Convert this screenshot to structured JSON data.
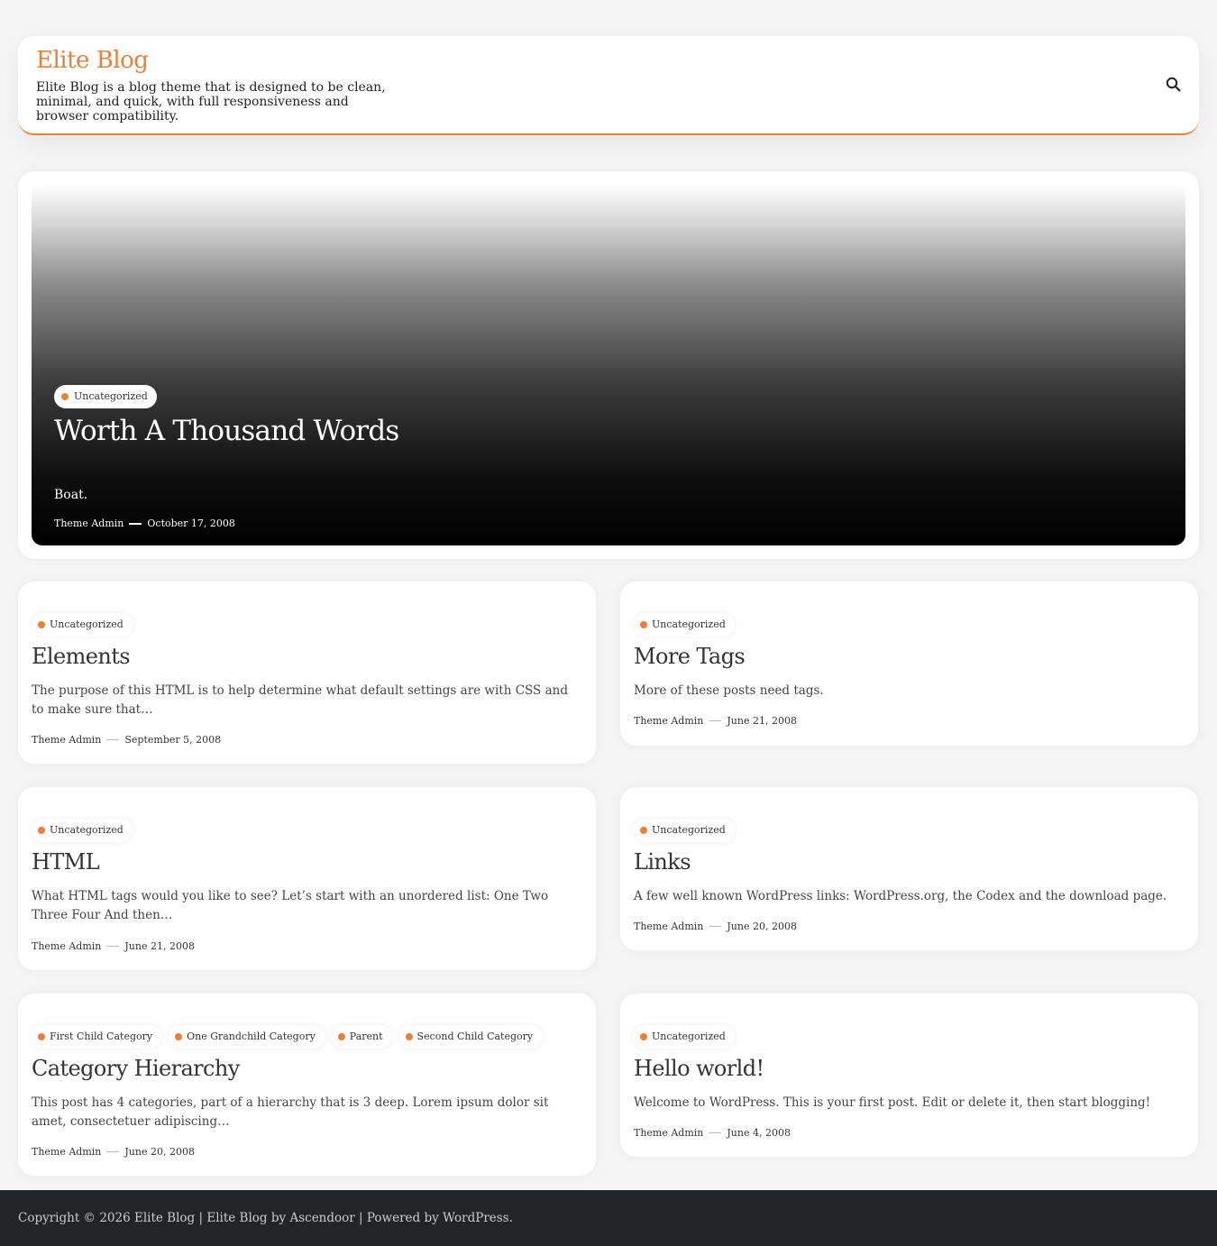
{
  "header": {
    "site_title": "Elite Blog",
    "site_description": "Elite Blog is a blog theme that is designed to be clean, minimal, and quick, with full responsiveness and browser compatibility.",
    "search_icon": "search-icon"
  },
  "featured": {
    "category": "Uncategorized",
    "title": "Worth A Thousand Words",
    "excerpt": "Boat.",
    "author": "Theme Admin",
    "date": "October 17, 2008"
  },
  "posts": [
    {
      "categories": [
        "Uncategorized"
      ],
      "title": "Elements",
      "excerpt": "The purpose of this HTML is to help determine what default settings are with CSS and to make sure that…",
      "author": "Theme Admin",
      "date": "September 5, 2008"
    },
    {
      "categories": [
        "Uncategorized"
      ],
      "title": "More Tags",
      "excerpt": "More of these posts need tags.",
      "author": "Theme Admin",
      "date": "June 21, 2008"
    },
    {
      "categories": [
        "Uncategorized"
      ],
      "title": "HTML",
      "excerpt": "What HTML tags would you like to see? Let’s start with an unordered list: One Two Three Four And then…",
      "author": "Theme Admin",
      "date": "June 21, 2008"
    },
    {
      "categories": [
        "Uncategorized"
      ],
      "title": "Links",
      "excerpt": "A few well known WordPress links: WordPress.org, the Codex and the download page.",
      "author": "Theme Admin",
      "date": "June 20, 2008"
    },
    {
      "categories": [
        "First Child Category",
        "One Grandchild Category",
        "Parent",
        "Second Child Category"
      ],
      "title": "Category Hierarchy",
      "excerpt": "This post has 4 categories, part of a hierarchy that is 3 deep. Lorem ipsum dolor sit amet, consectetuer adipiscing…",
      "author": "Theme Admin",
      "date": "June 20, 2008"
    },
    {
      "categories": [
        "Uncategorized"
      ],
      "title": "Hello world!",
      "excerpt": "Welcome to WordPress. This is your first post. Edit or delete it, then start blogging!",
      "author": "Theme Admin",
      "date": "June 4, 2008"
    }
  ],
  "footer": {
    "copyright": "Copyright © 2026 Elite Blog",
    "separator1": "|",
    "theme_name": "Elite Blog",
    "by": "by",
    "author_link": "Ascendoor",
    "separator2": "|",
    "powered_by": "Powered by",
    "wp_link": "WordPress",
    "end": "."
  },
  "colors": {
    "accent": "#e8803a",
    "footer_bg": "#232427",
    "page_bg": "#f5f5f5"
  }
}
